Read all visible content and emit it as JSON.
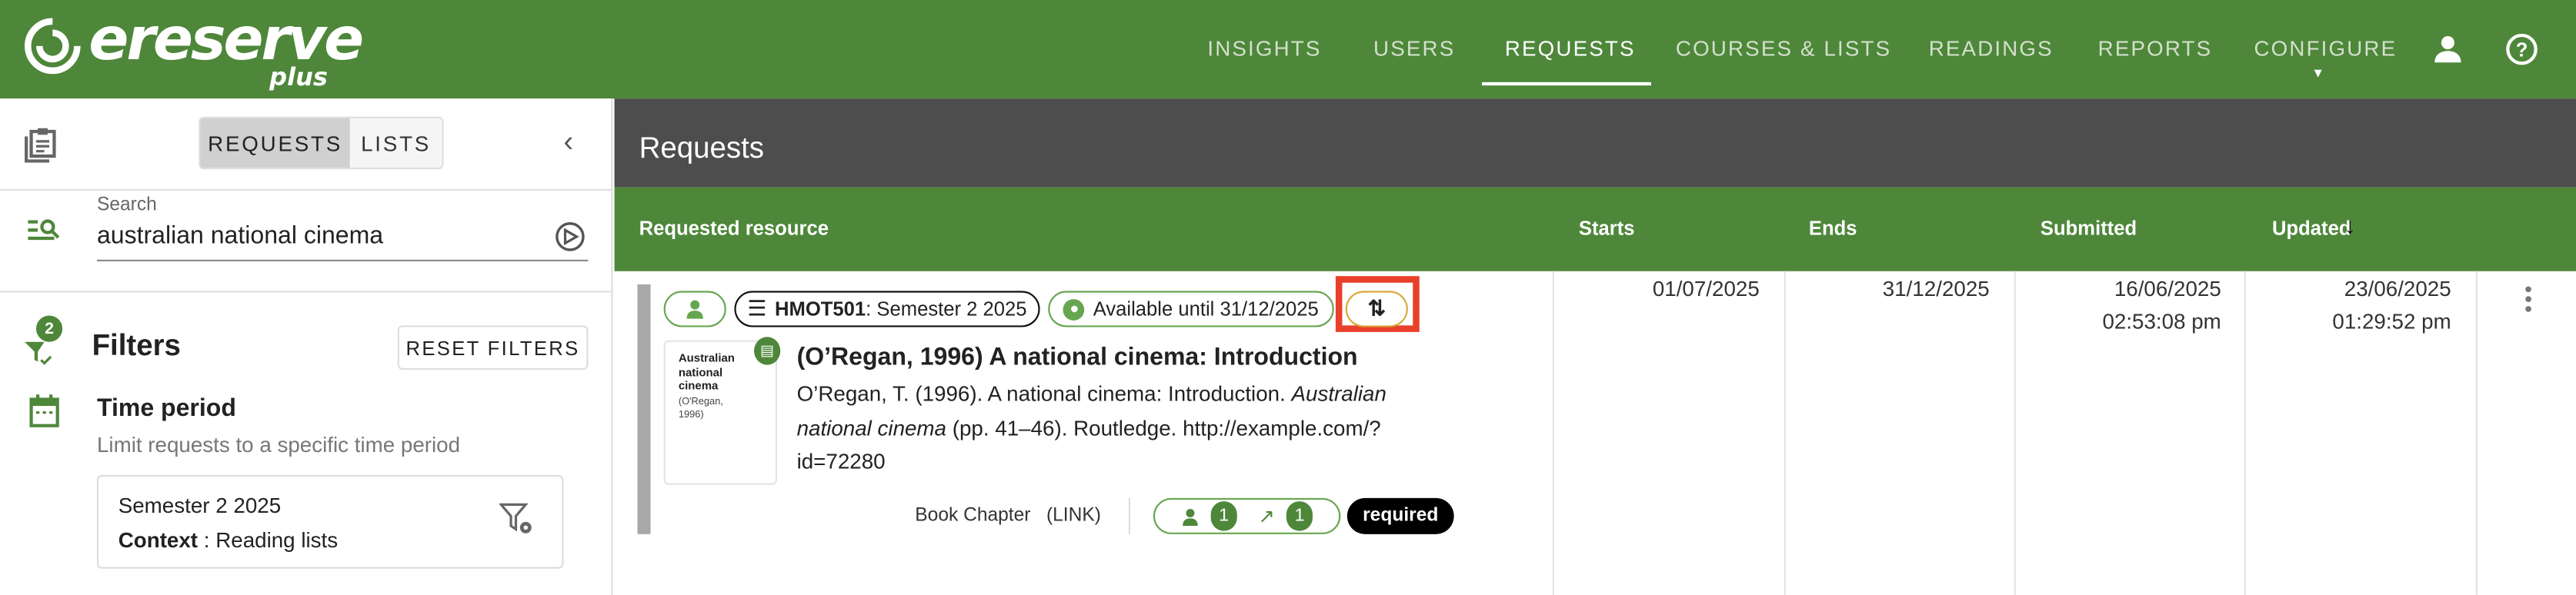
{
  "app": {
    "logo_text": "ereserve",
    "logo_sub": "plus"
  },
  "nav": {
    "items": [
      "INSIGHTS",
      "USERS",
      "REQUESTS",
      "COURSES & LISTS",
      "READINGS",
      "REPORTS",
      "CONFIGURE"
    ],
    "active": "REQUESTS"
  },
  "sidebar": {
    "toggle": {
      "requests": "REQUESTS",
      "lists": "LISTS",
      "selected": "REQUESTS"
    },
    "search": {
      "label": "Search",
      "value": "australian national cinema"
    },
    "filters": {
      "title": "Filters",
      "count": "2",
      "reset_label": "RESET FILTERS"
    },
    "time_period": {
      "title": "Time period",
      "subtitle": "Limit requests to a specific time period",
      "value": "Semester 2 2025",
      "context_label": "Context",
      "context_sep": " : ",
      "context_value": "Reading lists"
    }
  },
  "main": {
    "title": "Requests",
    "columns": [
      "Requested resource",
      "Starts",
      "Ends",
      "Submitted",
      "Updated"
    ],
    "sort_column": "Updated",
    "rows": [
      {
        "course_code": "HMOT501",
        "course_term": ": Semester 2 2025",
        "availability": "Available until 31/12/2025",
        "thumb_title": "Australian national cinema",
        "thumb_author": "(O'Regan, 1996)",
        "title": "(O’Regan, 1996) A national cinema: Introduction",
        "citation_a": "O’Regan, T. (1996). A national cinema: Introduction. ",
        "citation_italic_1": "Australian",
        "citation_italic_2": "national cinema",
        "citation_b": " (pp. 41–46). Routledge. http://example.com/?",
        "citation_c": "id=72280",
        "type": "Book Chapter",
        "format": "(LINK)",
        "users_count": "1",
        "links_count": "1",
        "required": "required",
        "starts": "01/07/2025",
        "ends": "31/12/2025",
        "submitted_date": "16/06/2025",
        "submitted_time": "02:53:08 pm",
        "updated_date": "23/06/2025",
        "updated_time": "01:29:52 pm"
      }
    ]
  },
  "colors": {
    "brand": "#4e873a",
    "dark": "#4d4d4d",
    "highlight": "#e8402a",
    "rollover": "#d8a93a"
  }
}
